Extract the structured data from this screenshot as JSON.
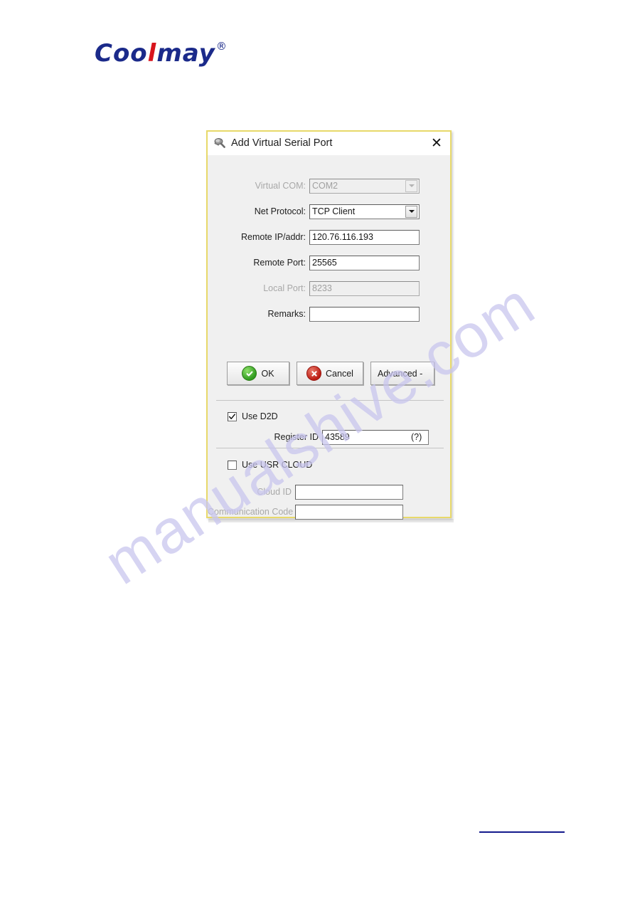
{
  "brand": {
    "name_part1": "Coo",
    "name_red": "l",
    "name_part2": "may",
    "registered_mark": "®"
  },
  "watermark": {
    "text": "manualshive.com"
  },
  "dialog": {
    "title": "Add Virtual Serial Port",
    "icon": "magnifier-icon",
    "close_label": "✕",
    "border_color": "#e8d96a",
    "fields": [
      {
        "label": "Virtual COM:",
        "type": "combobox",
        "value": "COM2",
        "placeholder": "",
        "disabled": true
      },
      {
        "label": "Net Protocol:",
        "type": "combobox",
        "value": "TCP Client",
        "placeholder": "",
        "disabled": false
      },
      {
        "label": "Remote IP/addr:",
        "type": "text",
        "value": "120.76.116.193",
        "placeholder": "",
        "disabled": false
      },
      {
        "label": "Remote Port:",
        "type": "text",
        "value": "25565",
        "placeholder": "",
        "disabled": false
      },
      {
        "label": "Local Port:",
        "type": "text",
        "value": "8233",
        "placeholder": "",
        "disabled": true
      },
      {
        "label": "Remarks:",
        "type": "text",
        "value": "",
        "placeholder": "",
        "disabled": false
      }
    ],
    "buttons": {
      "ok": "OK",
      "cancel": "Cancel",
      "advanced": "Advanced -"
    },
    "d2d": {
      "checkbox_label": "Use D2D",
      "checked": true,
      "register_id_label": "Register ID",
      "register_id_value": "43589",
      "help_label": "(?)"
    },
    "usr_cloud": {
      "checkbox_label": "Use USR CLOUD",
      "checked": false,
      "cloud_id_label": "Cloud ID",
      "cloud_id_value": "",
      "communication_code_label": "Communication Code",
      "communication_code_value": ""
    }
  }
}
